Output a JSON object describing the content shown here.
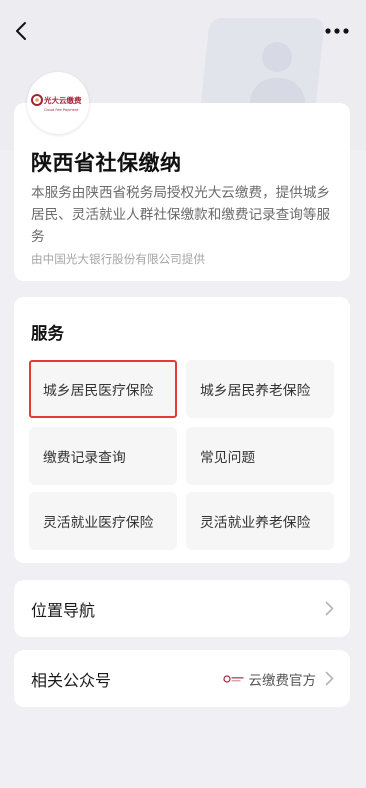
{
  "colors": {
    "page_bg": "#efeff4",
    "card_bg": "#ffffff",
    "highlight_border": "#e53935",
    "logo_brand": "#a0253b"
  },
  "icons": {
    "back": "chevron-left-icon",
    "more": "more-dots-icon",
    "chevron": "chevron-right-icon",
    "logo": "guangda-yunjiaofei-logo"
  },
  "logo": {
    "text_cn": "光大云缴费",
    "text_en": "Cloud Fee Payment"
  },
  "intro": {
    "title": "陕西省社保缴纳",
    "description": "本服务由陕西省税务局授权光大云缴费，提供城乡居民、灵活就业人群社保缴款和缴费记录查询等服务",
    "provider": "由中国光大银行股份有限公司提供"
  },
  "services": {
    "title": "服务",
    "items": [
      {
        "label": "城乡居民医疗保险",
        "highlighted": true
      },
      {
        "label": "城乡居民养老保险",
        "highlighted": false
      },
      {
        "label": "缴费记录查询",
        "highlighted": false
      },
      {
        "label": "常见问题",
        "highlighted": false
      },
      {
        "label": "灵活就业医疗保险",
        "highlighted": false
      },
      {
        "label": "灵活就业养老保险",
        "highlighted": false
      }
    ]
  },
  "navigation": {
    "label": "位置导航"
  },
  "official_account": {
    "label": "相关公众号",
    "account_name": "云缴费官方"
  }
}
